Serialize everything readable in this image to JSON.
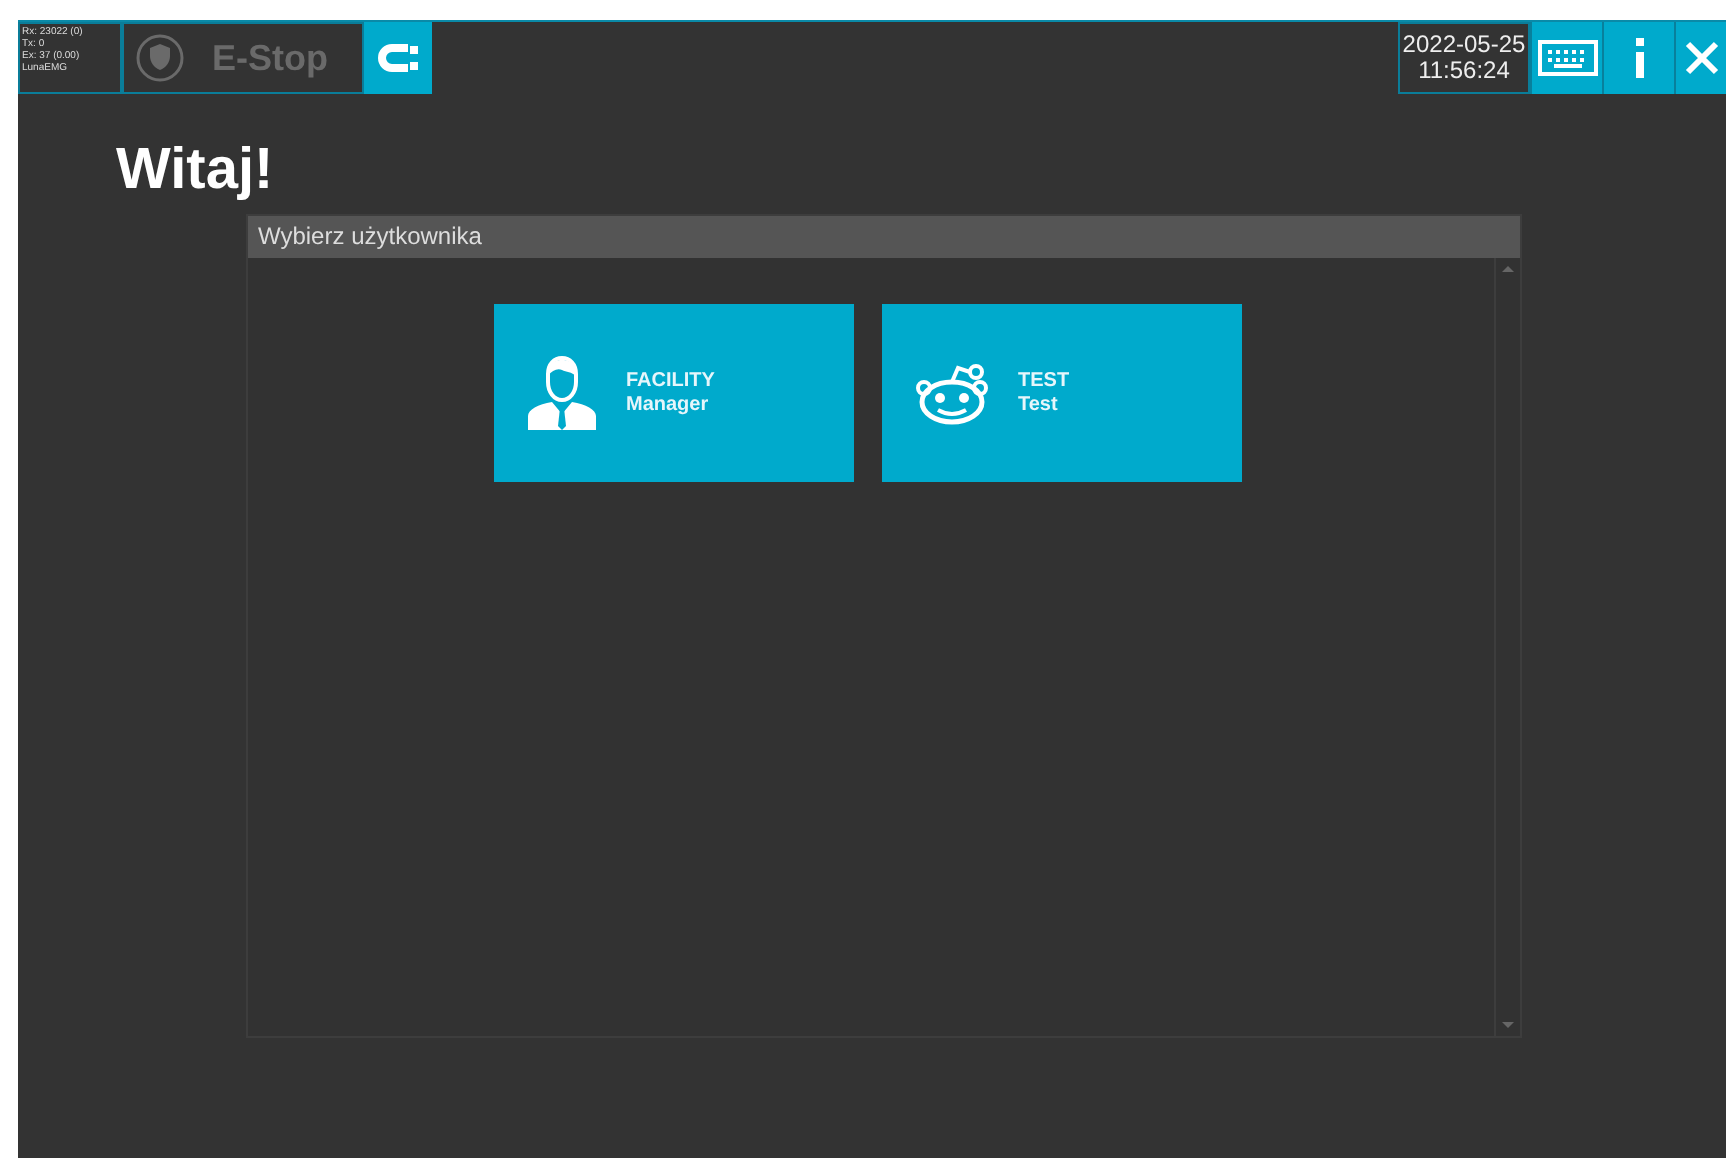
{
  "status_lines": [
    "Rx: 23022 (0)",
    "Tx: 0",
    "Ex: 37 (0.00)",
    "LunaEMG"
  ],
  "estop": {
    "label": "E-Stop",
    "disabled": true
  },
  "clock": {
    "date": "2022-05-25",
    "time": "11:56:24"
  },
  "greeting": "Witaj!",
  "panel": {
    "title": "Wybierz użytkownika",
    "users": [
      {
        "kind": "person",
        "name": "FACILITY",
        "role": "Manager"
      },
      {
        "kind": "robot",
        "name": "TEST",
        "role": "Test"
      }
    ]
  }
}
